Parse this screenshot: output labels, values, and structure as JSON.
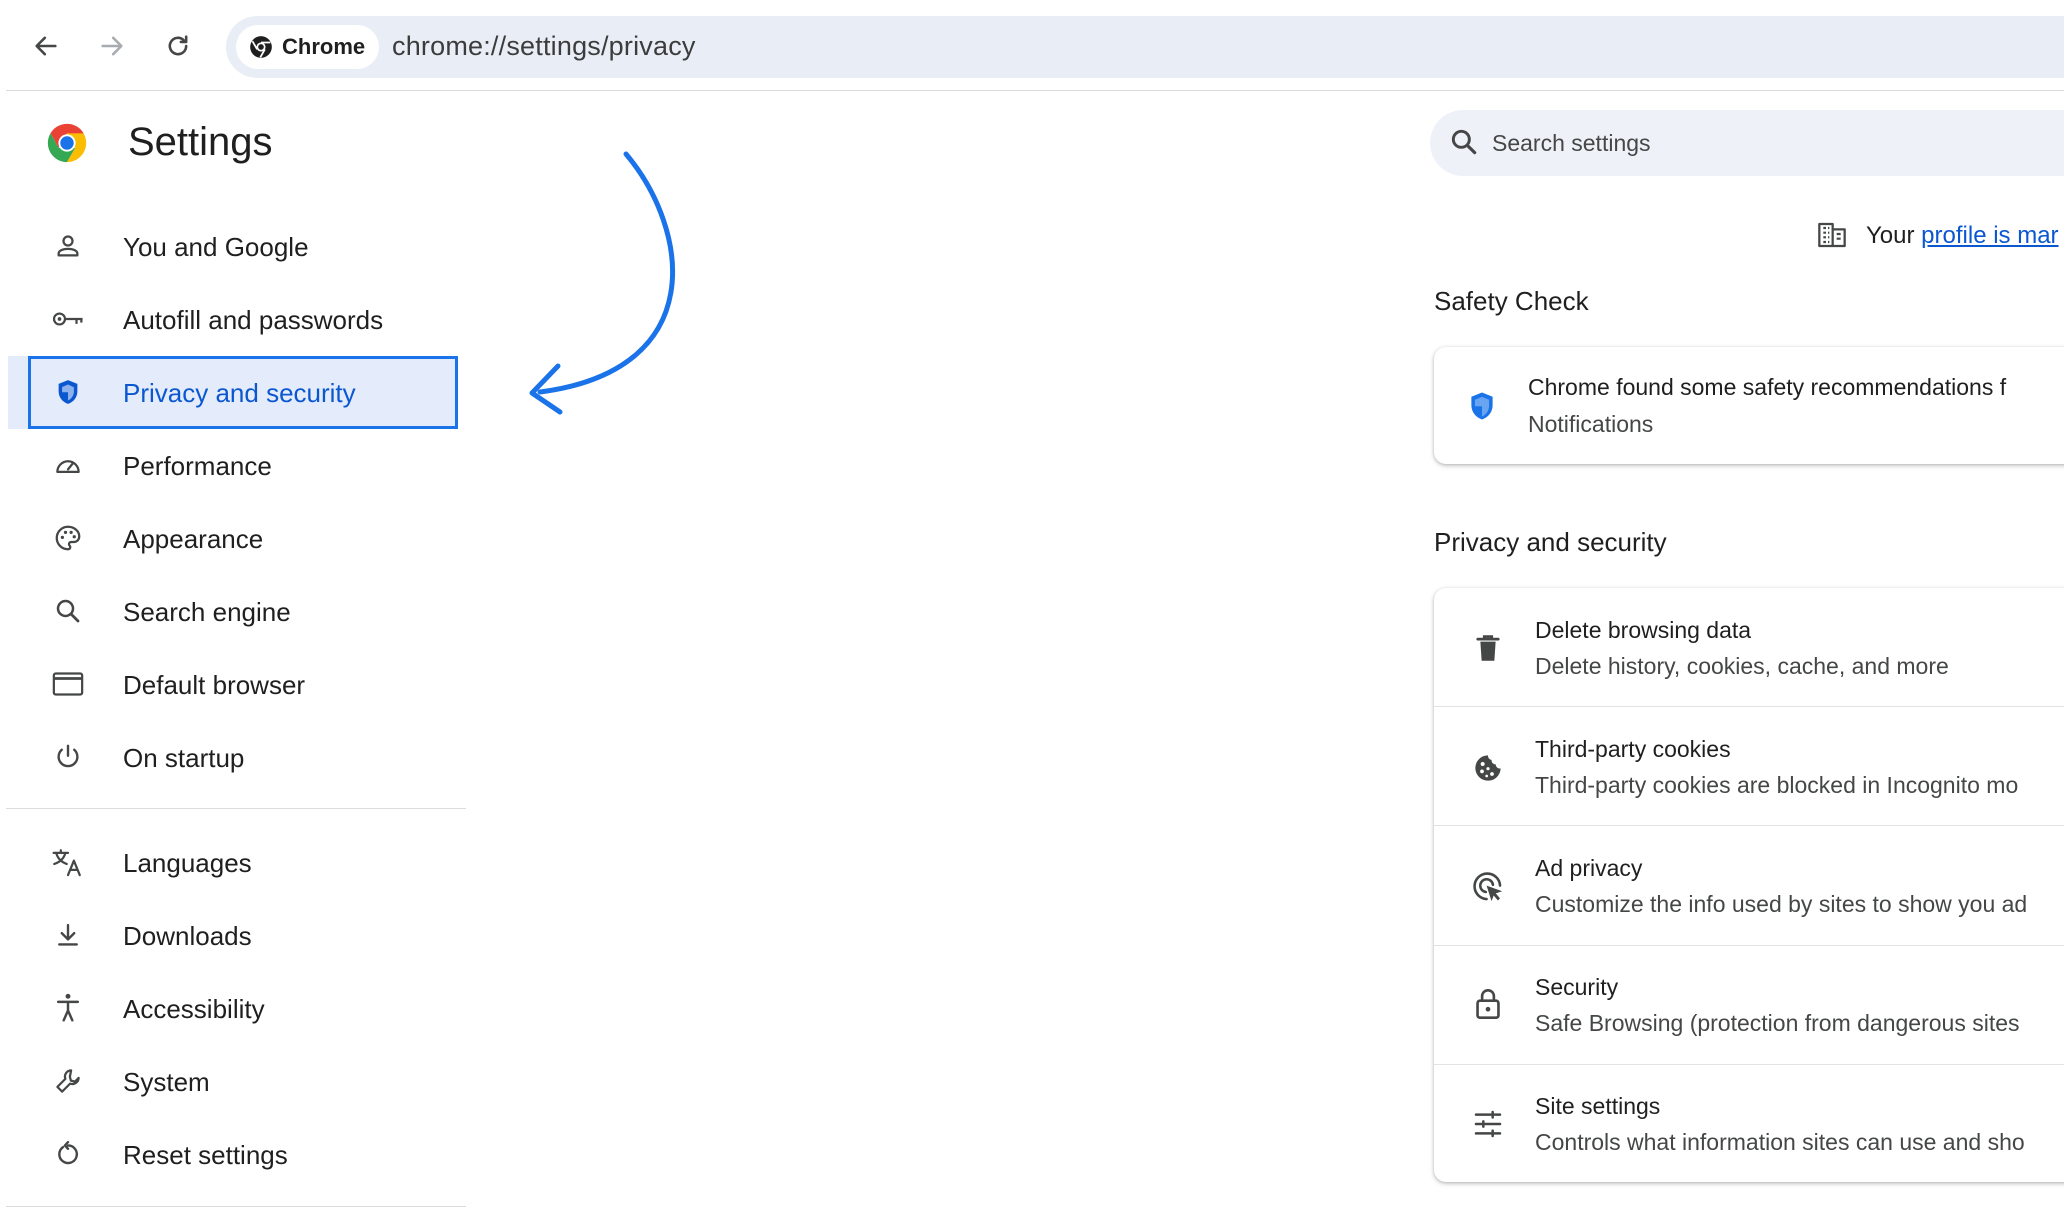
{
  "toolbar": {
    "chip_label": "Chrome",
    "url": "chrome://settings/privacy"
  },
  "sidebar": {
    "title": "Settings",
    "items": [
      {
        "label": "You and Google",
        "icon": "person-icon"
      },
      {
        "label": "Autofill and passwords",
        "icon": "key-icon"
      },
      {
        "label": "Privacy and security",
        "icon": "shield-icon",
        "selected": true
      },
      {
        "label": "Performance",
        "icon": "speedometer-icon"
      },
      {
        "label": "Appearance",
        "icon": "palette-icon"
      },
      {
        "label": "Search engine",
        "icon": "search-icon"
      },
      {
        "label": "Default browser",
        "icon": "browser-window-icon"
      },
      {
        "label": "On startup",
        "icon": "power-icon"
      },
      {
        "label": "Languages",
        "icon": "translate-icon"
      },
      {
        "label": "Downloads",
        "icon": "download-icon"
      },
      {
        "label": "Accessibility",
        "icon": "accessibility-icon"
      },
      {
        "label": "System",
        "icon": "wrench-icon"
      },
      {
        "label": "Reset settings",
        "icon": "reset-icon"
      }
    ]
  },
  "search": {
    "placeholder": "Search settings"
  },
  "managed": {
    "prefix": "Your",
    "link": "profile is mar"
  },
  "safety_check": {
    "section_title": "Safety Check",
    "title": "Chrome found some safety recommendations f",
    "subtitle": "Notifications"
  },
  "privacy": {
    "section_title": "Privacy and security",
    "rows": [
      {
        "title": "Delete browsing data",
        "subtitle": "Delete history, cookies, cache, and more",
        "icon": "trash-icon"
      },
      {
        "title": "Third-party cookies",
        "subtitle": "Third-party cookies are blocked in Incognito mo",
        "icon": "cookie-icon"
      },
      {
        "title": "Ad privacy",
        "subtitle": "Customize the info used by sites to show you ad",
        "icon": "ad-privacy-icon"
      },
      {
        "title": "Security",
        "subtitle": "Safe Browsing (protection from dangerous sites",
        "icon": "lock-icon"
      },
      {
        "title": "Site settings",
        "subtitle": "Controls what information sites can use and sho",
        "icon": "sliders-icon"
      }
    ]
  },
  "colors": {
    "accent": "#1a73e8",
    "selected_bg": "#e4ecfb",
    "omnibox_bg": "#e9eef6"
  }
}
